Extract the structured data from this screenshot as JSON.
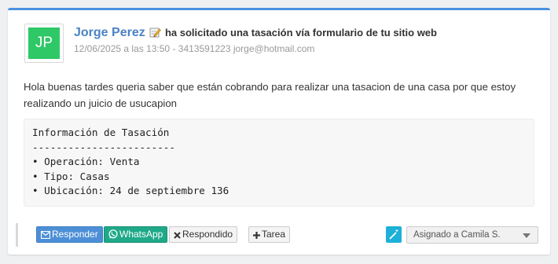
{
  "lead": {
    "avatar_initials": "JP",
    "avatar_color": "#2ec866",
    "author": "Jorge Perez",
    "action": "ha solicitado una tasación vía formulario de tu sitio web",
    "meta": "12/06/2025 a las 13:50 - 3413591223 jorge@hotmail.com",
    "message": "Hola buenas tardes queria saber que están cobrando para realizar una tasacion de una casa por que estoy realizando un juicio de usucapion",
    "details": {
      "title": "Información de Tasación",
      "separator": "------------------------",
      "items": [
        "• Operación: Venta",
        "• Tipo: Casas",
        "• Ubicación: 24 de septiembre 136"
      ]
    }
  },
  "actions": {
    "reply_label": "Responder",
    "whatsapp_label": "WhatsApp",
    "answered_label": "Respondido",
    "task_label": "Tarea",
    "assign_selected": "Asignado a Camila S."
  },
  "icons": {
    "note": "note-pencil-icon",
    "reply": "envelope-icon",
    "whatsapp": "whatsapp-icon",
    "answered": "x-mark-icon",
    "task": "plus-icon",
    "magic": "magic-wand-icon",
    "dropdown": "caret-down-icon"
  },
  "colors": {
    "accent_top": "#4a90e2",
    "author": "#4a82c4",
    "reply_button": "#4c8fd6",
    "whatsapp_button": "#1fa988",
    "magic_button": "#1db0d9"
  }
}
